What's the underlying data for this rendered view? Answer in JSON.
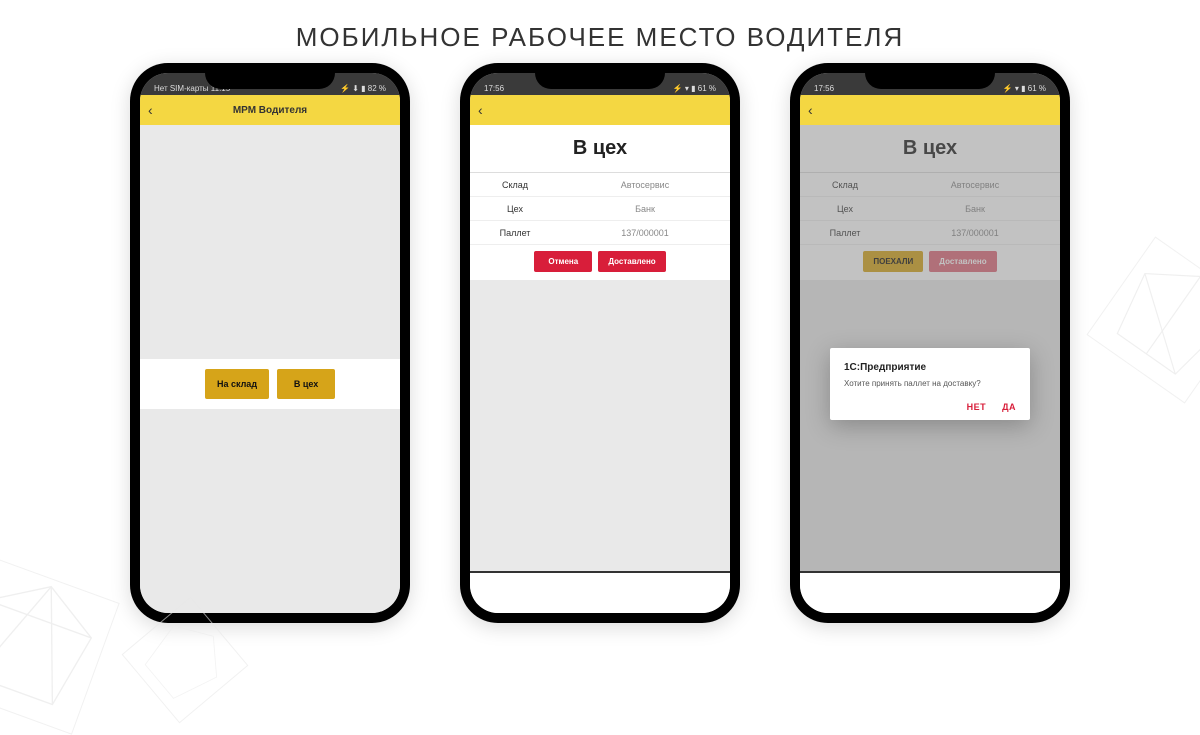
{
  "page": {
    "title": "МОБИЛЬНОЕ РАБОЧЕЕ МЕСТО ВОДИТЕЛЯ"
  },
  "phones": [
    {
      "status_left": "Нет SIM-карты 11:15",
      "status_right": "⚡ ⬇ ▮ 82 %",
      "appbar_title": "МРМ Водителя",
      "buttons": {
        "to_warehouse": "На склад",
        "to_shop": "В цех"
      }
    },
    {
      "status_left": "17:56",
      "status_right": "⚡ ▾ ▮ 61 %",
      "section_title": "В цех",
      "rows": [
        {
          "label": "Склад",
          "value": "Автосервис"
        },
        {
          "label": "Цех",
          "value": "Банк"
        },
        {
          "label": "Паллет",
          "value": "137/000001"
        }
      ],
      "buttons": {
        "cancel": "Отмена",
        "delivered": "Доставлено"
      }
    },
    {
      "status_left": "17:56",
      "status_right": "⚡ ▾ ▮ 61 %",
      "section_title": "В цех",
      "rows": [
        {
          "label": "Склад",
          "value": "Автосервис"
        },
        {
          "label": "Цех",
          "value": "Банк"
        },
        {
          "label": "Паллет",
          "value": "137/000001"
        }
      ],
      "buttons": {
        "go": "ПОЕХАЛИ",
        "delivered": "Доставлено"
      },
      "dialog": {
        "title": "1С:Предприятие",
        "text": "Хотите принять паллет на доставку?",
        "no": "НЕТ",
        "yes": "ДА"
      }
    }
  ]
}
